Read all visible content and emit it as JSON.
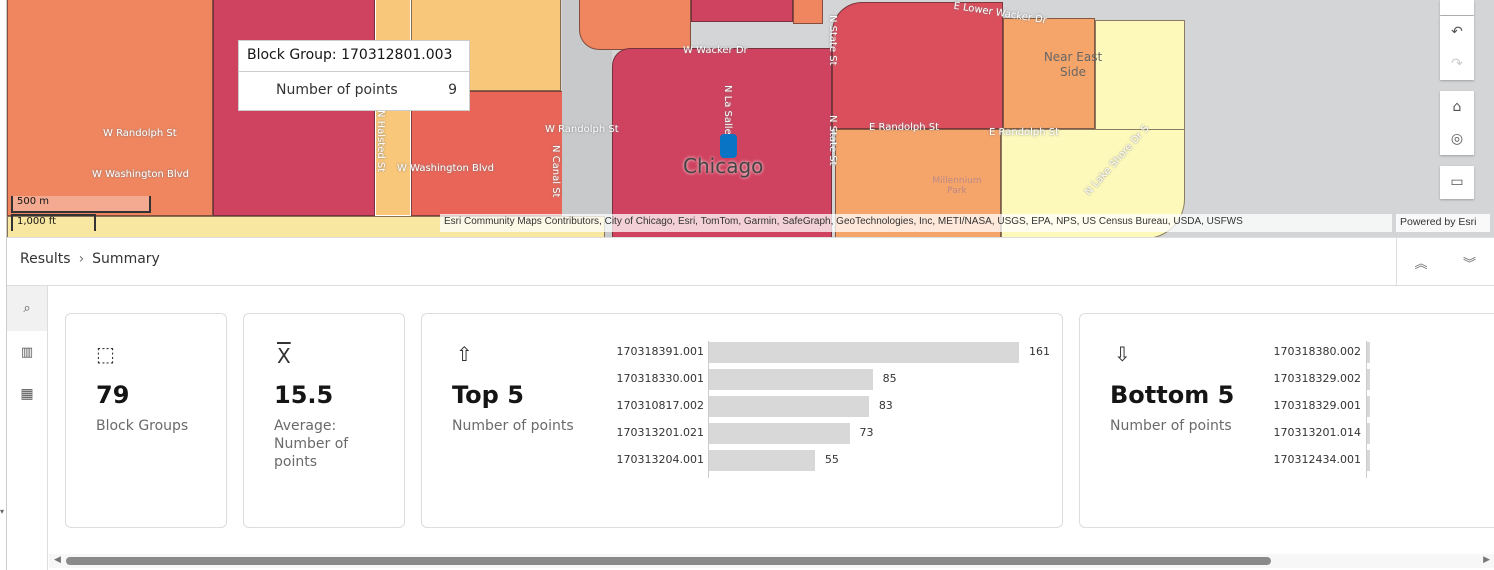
{
  "map": {
    "street_labels": [
      "W Randolph St",
      "W Washington Blvd",
      "N Halsted St",
      "W Washington Blvd",
      "W Randolph St",
      "N Canal St",
      "W Wacker Dr",
      "N La Salle St",
      "N State St",
      "N State St",
      "E Lower Wacker Dr",
      "E Randolph St",
      "E Randolph St",
      "N Lake Shore Dr S"
    ],
    "place_labels": {
      "city": "Chicago",
      "near_east": "Near East Side",
      "park": "Millennium Park"
    },
    "scale": {
      "metric": "500 m",
      "imperial": "1,000 ft"
    },
    "attribution": "Esri Community Maps Contributors, City of Chicago, Esri, TomTom, Garmin, SafeGraph, GeoTechnologies, Inc, METI/NASA, USGS, EPA, NPS, US Census Bureau, USDA, USFWS",
    "powered_by": "Powered by Esri",
    "colors": {
      "class1": "#fdf9bb",
      "class2": "#f8c77a",
      "class3": "#f5a56a",
      "class4": "#ef8660",
      "class5": "#e86558",
      "class6": "#cf4360"
    },
    "controls": [
      "undo-icon",
      "redo-icon",
      "home-icon",
      "locate-icon",
      "screen-icon"
    ]
  },
  "tooltip": {
    "title": "Block Group: 170312801.003",
    "field": "Number of points",
    "value": "9"
  },
  "panel": {
    "breadcrumb": [
      "Results",
      "Summary"
    ],
    "rail": [
      "summary-icon",
      "chart-icon",
      "table-icon"
    ],
    "cards": {
      "count": {
        "value": "79",
        "label": "Block Groups"
      },
      "average": {
        "value": "15.5",
        "label": "Average: Number of points"
      },
      "top": {
        "title": "Top 5",
        "label": "Number of points"
      },
      "bottom": {
        "title": "Bottom 5",
        "label": "Number of points"
      }
    }
  },
  "chart_data": [
    {
      "type": "bar",
      "orientation": "horizontal",
      "title": "Top 5",
      "categories": [
        "170318391.001",
        "170318330.001",
        "170310817.002",
        "170313201.021",
        "170313204.001"
      ],
      "values": [
        161,
        85,
        83,
        73,
        55
      ]
    },
    {
      "type": "bar",
      "orientation": "horizontal",
      "title": "Bottom 5",
      "categories": [
        "170318380.002",
        "170318329.002",
        "170318329.001",
        "170313201.014",
        "170312434.001"
      ]
    }
  ]
}
